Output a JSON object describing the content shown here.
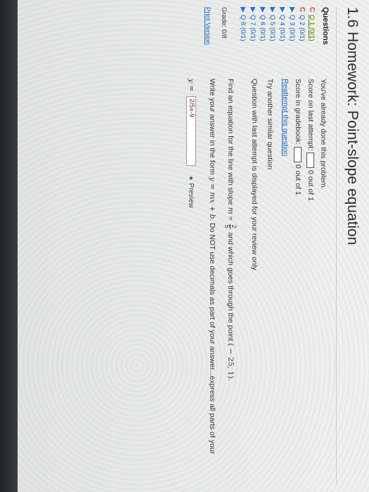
{
  "header": {
    "title": "1.6 Homework: Point-slope equation"
  },
  "sidebar": {
    "heading": "Questions",
    "items": [
      {
        "mark": "C",
        "label": "Q 1 (0/1)",
        "current": true
      },
      {
        "mark": "C",
        "label": "Q 2 (0/1)",
        "current": false
      },
      {
        "mark": "▶",
        "label": "Q 3 (0/1)",
        "current": false
      },
      {
        "mark": "▶",
        "label": "Q 4 (0/1)",
        "current": false
      },
      {
        "mark": "▶",
        "label": "Q 5 (0/1)",
        "current": false
      },
      {
        "mark": "▶",
        "label": "Q 6 (0/1)",
        "current": false
      },
      {
        "mark": "▶",
        "label": "Q 7 (0/1)",
        "current": false
      },
      {
        "mark": "▶",
        "label": "Q 8 (0/1)",
        "current": false
      }
    ],
    "grade": "Grade: 0/8",
    "print_version": "Print Version"
  },
  "main": {
    "done_text": "You've already done this problem.",
    "score_last_label": "Score on last attempt:",
    "score_last_value": "0 out of 1",
    "score_gradebook_label": "Score in gradebook:",
    "score_gradebook_value": "0 out of 1",
    "reattempt": "Reattempt this question",
    "similar": "Try another similar question",
    "review_note": "Question with last attempt is displayed for your review only",
    "question": {
      "prefix": "Find an equation for the line with slope ",
      "slope_var": "m",
      "eq": " = ",
      "slope_num": "2",
      "slope_den": "5",
      "middle": " and which goes through the point ",
      "point": "( − 25, 1).",
      "instr_prefix": "Write your answer in the form ",
      "form": "y = mx + b",
      "instr_suffix": ". Do NOT use decimals as part of your answer...express all parts of your"
    },
    "answer": {
      "var": "y = ",
      "value": "2/5x-9",
      "preview": "Preview"
    }
  }
}
